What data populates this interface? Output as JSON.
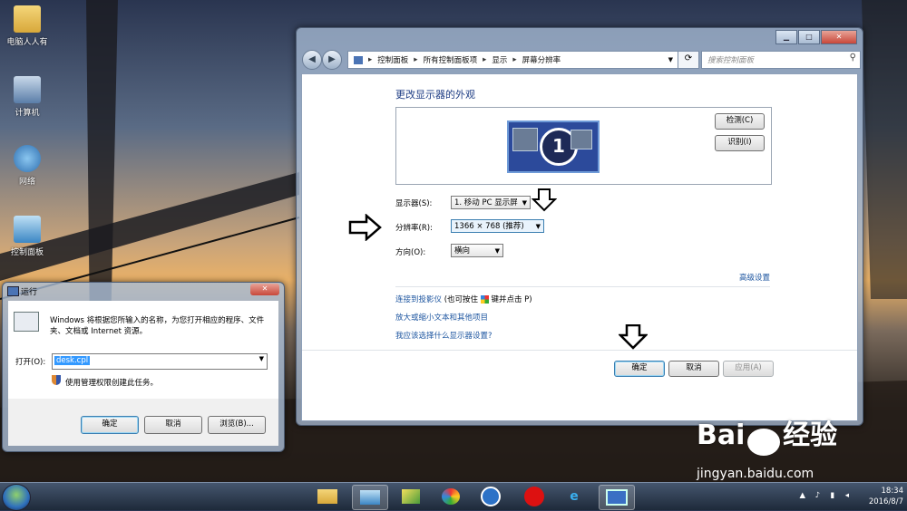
{
  "desktop": {
    "icons": [
      {
        "label": "电脑人人有",
        "icon": "folder-icon"
      },
      {
        "label": "计算机",
        "icon": "computer-icon"
      },
      {
        "label": "网络",
        "icon": "network-icon"
      },
      {
        "label": "控制面板",
        "icon": "control-panel-icon"
      }
    ]
  },
  "display_window": {
    "caption_buttons": {
      "minimize": "▁",
      "maximize": "□",
      "close": "✕"
    },
    "breadcrumb": [
      "控制面板",
      "所有控制面板项",
      "显示",
      "屏幕分辨率"
    ],
    "search_placeholder": "搜索控制面板",
    "heading": "更改显示器的外观",
    "monitor_number": "1",
    "detect_button": "检测(C)",
    "identify_button": "识别(I)",
    "display_label": "显示器(S):",
    "display_value": "1. 移动 PC 显示屏",
    "resolution_label": "分辨率(R):",
    "resolution_value": "1366 × 768 (推荐)",
    "orientation_label": "方向(O):",
    "orientation_value": "横向",
    "advanced_link": "高级设置",
    "projector_link": "连接到投影仪",
    "projector_hint_prefix": "(也可按住",
    "projector_hint_suffix": "键并点击 P)",
    "text_size_link": "放大或缩小文本和其他项目",
    "which_settings_link": "我应该选择什么显示器设置?",
    "ok_button": "确定",
    "cancel_button": "取消",
    "apply_button": "应用(A)"
  },
  "run_dialog": {
    "title": "运行",
    "close": "✕",
    "description": "Windows 将根据您所输入的名称，为您打开相应的程序、文件夹、文档或 Internet 资源。",
    "open_label": "打开(O):",
    "open_value": "desk.cpl",
    "admin_note": "使用管理权限创建此任务。",
    "ok_button": "确定",
    "cancel_button": "取消",
    "browse_button": "浏览(B)..."
  },
  "taskbar": {
    "items": [
      "folder-icon",
      "control-panel-icon",
      "photo-icon",
      "paint-icon",
      "sogou-icon",
      "chess-icon",
      "ie-icon",
      "display-icon"
    ],
    "time": "18:34",
    "date": "2016/8/7"
  },
  "watermark": {
    "brand": "Bai",
    "brand_cn": "经验",
    "url": "jingyan.baidu.com"
  },
  "colors": {
    "link": "#1e56a0",
    "heading": "#1e3d84",
    "selection": "#3399ff"
  }
}
